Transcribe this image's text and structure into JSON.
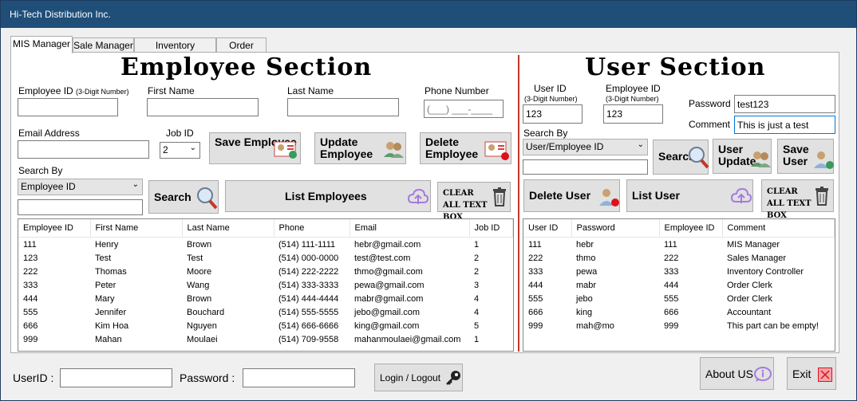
{
  "window": {
    "title": "Hi-Tech Distribution Inc."
  },
  "tabs": [
    "MIS Manager",
    "Sale Manager",
    "Inventory Controller",
    "Order Clerk"
  ],
  "employee": {
    "heading": "Employee Section",
    "id_label": "Employee ID",
    "id_hint": "(3-Digit Number)",
    "first_label": "First Name",
    "last_label": "Last Name",
    "phone_label": "Phone Number",
    "phone_mask": "(___) ___-____",
    "email_label": "Email Address",
    "jobid_label": "Job ID",
    "jobid_value": "2",
    "save_label": "Save Employee",
    "update_label": "Update Employee",
    "delete_label": "Delete Employee",
    "search_by_label": "Search By",
    "search_by_value": "Employee ID",
    "search_label": "Search",
    "list_label": "List Employees",
    "clear_label": "CLEAR ALL TEXT BOX",
    "columns": [
      "Employee ID",
      "First Name",
      "Last Name",
      "Phone",
      "Email",
      "Job ID"
    ],
    "rows": [
      [
        "111",
        "Henry",
        "Brown",
        "(514) 111-1111",
        "hebr@gmail.com",
        "1"
      ],
      [
        "123",
        "Test",
        "Test",
        "(514) 000-0000",
        "test@test.com",
        "2"
      ],
      [
        "222",
        "Thomas",
        "Moore",
        "(514) 222-2222",
        "thmo@gmail.com",
        "2"
      ],
      [
        "333",
        "Peter",
        "Wang",
        "(514) 333-3333",
        "pewa@gmail.com",
        "3"
      ],
      [
        "444",
        "Mary",
        "Brown",
        "(514) 444-4444",
        "mabr@gmail.com",
        "4"
      ],
      [
        "555",
        "Jennifer",
        "Bouchard",
        "(514) 555-5555",
        "jebo@gmail.com",
        "4"
      ],
      [
        "666",
        "Kim Hoa",
        "Nguyen",
        "(514) 666-6666",
        "king@gmail.com",
        "5"
      ],
      [
        "999",
        "Mahan",
        "Moulaei",
        "(514) 709-9558",
        "mahanmoulaei@gmail.com",
        "1"
      ]
    ]
  },
  "user": {
    "heading": "User Section",
    "uid_label": "User ID",
    "uid_hint": "(3-Digit Number)",
    "uid_value": "123",
    "eid_label": "Employee ID",
    "eid_hint": "(3-Digit Number)",
    "eid_value": "123",
    "password_label": "Password",
    "password_value": "test123",
    "comment_label": "Comment",
    "comment_value": "This is just a test",
    "search_by_label": "Search By",
    "search_by_value": "User/Employee ID",
    "search_label": "Search",
    "update_label": "User Update",
    "save_label": "Save User",
    "delete_label": "Delete User",
    "list_label": "List User",
    "clear_label": "CLEAR ALL TEXT BOX",
    "columns": [
      "User ID",
      "Password",
      "Employee ID",
      "Comment"
    ],
    "rows": [
      [
        "111",
        "hebr",
        "111",
        "MIS Manager"
      ],
      [
        "222",
        "thmo",
        "222",
        "Sales Manager"
      ],
      [
        "333",
        "pewa",
        "333",
        "Inventory Controller"
      ],
      [
        "444",
        "mabr",
        "444",
        "Order Clerk"
      ],
      [
        "555",
        "jebo",
        "555",
        "Order Clerk"
      ],
      [
        "666",
        "king",
        "666",
        "Accountant"
      ],
      [
        "999",
        "mah@mo",
        "999",
        "This part can be empty!"
      ]
    ]
  },
  "footer": {
    "userid_label": "UserID :",
    "password_label": "Password :",
    "login_label": "Login / Logout",
    "about_label": "About US",
    "exit_label": "Exit"
  },
  "colors": {
    "titlebar": "#1f4e79",
    "divider": "#c0392b",
    "accent_focus": "#0078d7"
  }
}
